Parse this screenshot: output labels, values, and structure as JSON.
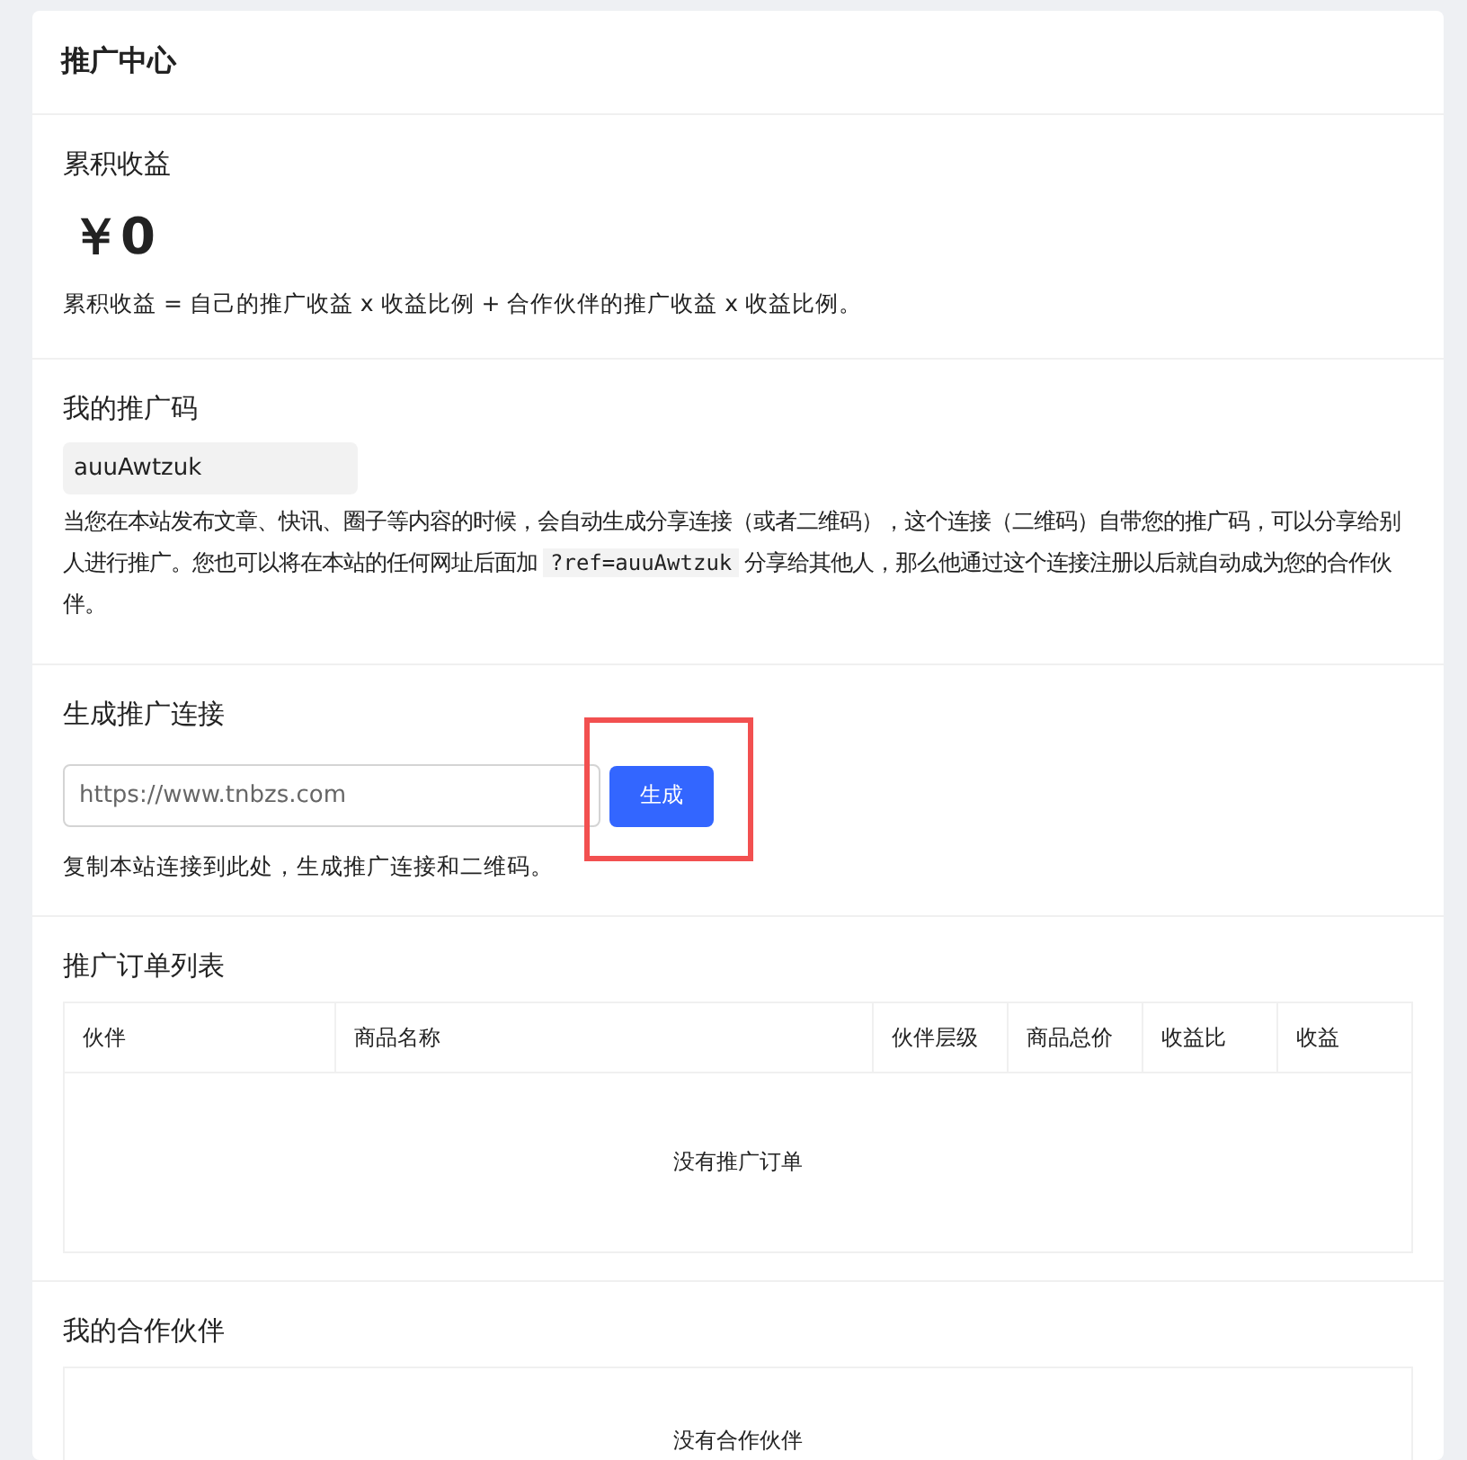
{
  "card": {
    "title": "推广中心"
  },
  "earnings": {
    "title": "累积收益",
    "amount": "￥0",
    "formula": "累积收益 = 自己的推广收益 x 收益比例 + 合作伙伴的推广收益 x 收益比例。"
  },
  "referral": {
    "title": "我的推广码",
    "code": "auuAwtzuk",
    "description": {
      "before": "当您在本站发布文章、快讯、圈子等内容的时候，会自动生成分享连接（或者二维码），这个连接（二维码）自带您的推广码，可以分享给别人进行推广。您也可以将在本站的任何网址后面加",
      "code": "?ref=auuAwtzuk",
      "after": "分享给其他人，那么他通过这个连接注册以后就自动成为您的合作伙伴。"
    }
  },
  "generate": {
    "title": "生成推广连接",
    "placeholder": "https://www.tnbzs.com",
    "button": "生成",
    "highlighted": true,
    "hint": "复制本站连接到此处，生成推广连接和二维码。"
  },
  "orders": {
    "title": "推广订单列表",
    "columns": [
      "伙伴",
      "商品名称",
      "伙伴层级",
      "商品总价",
      "收益比",
      "收益"
    ],
    "empty": "没有推广订单"
  },
  "partners": {
    "title": "我的合作伙伴",
    "empty": "没有合作伙伴"
  }
}
